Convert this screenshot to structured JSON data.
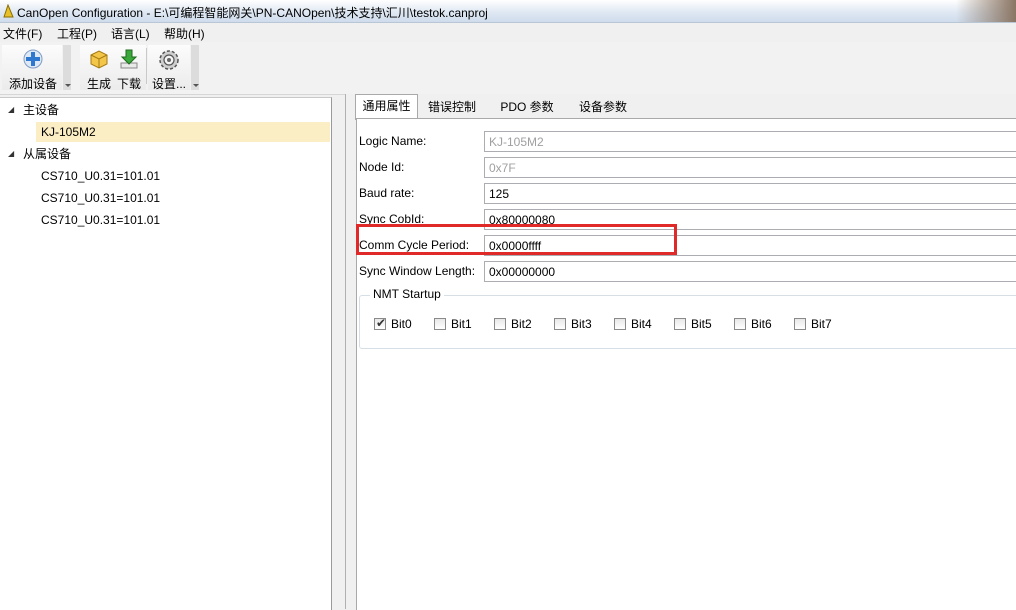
{
  "window": {
    "title": "CanOpen Configuration - E:\\可编程智能网关\\PN-CANOpen\\技术支持\\汇川\\testok.canproj"
  },
  "menu": [
    {
      "label": "文件(F)"
    },
    {
      "label": "工程(P)"
    },
    {
      "label": "语言(L)"
    },
    {
      "label": "帮助(H)"
    }
  ],
  "toolbar": {
    "add_device": "添加设备",
    "generate": "生成",
    "download": "下载",
    "settings": "设置..."
  },
  "tree": {
    "master_group": "主设备",
    "master_item": "KJ-105M2",
    "slave_group": "从属设备",
    "slaves": [
      "CS710_U0.31=101.01",
      "CS710_U0.31=101.01",
      "CS710_U0.31=101.01"
    ]
  },
  "tabs": [
    {
      "label": "通用属性"
    },
    {
      "label": "错误控制"
    },
    {
      "label": "PDO 参数"
    },
    {
      "label": "设备参数"
    }
  ],
  "props": {
    "logic_name": {
      "label": "Logic Name:",
      "value": "KJ-105M2"
    },
    "node_id": {
      "label": "Node Id:",
      "value": "0x7F"
    },
    "baud_rate": {
      "label": "Baud rate:",
      "value": "125"
    },
    "sync_cobid": {
      "label": "Sync CobId:",
      "value": "0x80000080"
    },
    "comm_cycle": {
      "label": "Comm Cycle Period:",
      "value": "0x0000ffff"
    },
    "sync_window": {
      "label": "Sync Window Length:",
      "value": "0x00000000"
    }
  },
  "nmt": {
    "legend": "NMT Startup",
    "bits": [
      {
        "label": "Bit0",
        "checked": true
      },
      {
        "label": "Bit1",
        "checked": false
      },
      {
        "label": "Bit2",
        "checked": false
      },
      {
        "label": "Bit3",
        "checked": false
      },
      {
        "label": "Bit4",
        "checked": false
      },
      {
        "label": "Bit5",
        "checked": false
      },
      {
        "label": "Bit6",
        "checked": false
      },
      {
        "label": "Bit7",
        "checked": false
      }
    ]
  },
  "colors": {
    "selection": "#fbedc4",
    "highlight_box": "#e02a2a"
  }
}
